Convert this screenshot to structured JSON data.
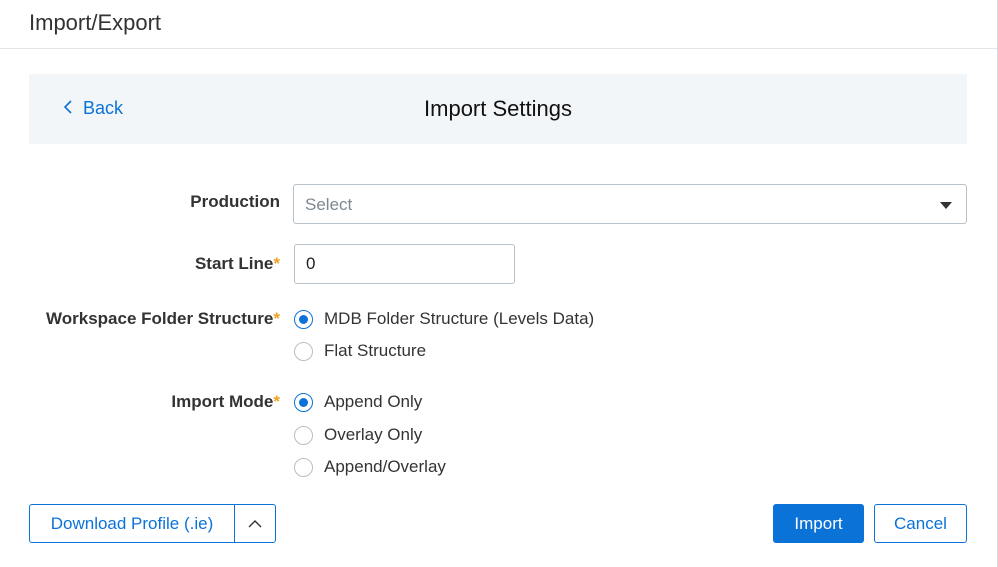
{
  "header": {
    "title": "Import/Export"
  },
  "settings": {
    "back_label": "Back",
    "title": "Import Settings"
  },
  "form": {
    "production": {
      "label": "Production",
      "placeholder": "Select",
      "value": ""
    },
    "start_line": {
      "label": "Start Line",
      "required_mark": "*",
      "value": "0"
    },
    "folder_structure": {
      "label": "Workspace Folder Structure",
      "required_mark": "*",
      "options": [
        {
          "label": "MDB Folder Structure (Levels Data)",
          "selected": true
        },
        {
          "label": "Flat Structure",
          "selected": false
        }
      ]
    },
    "import_mode": {
      "label": "Import Mode",
      "required_mark": "*",
      "options": [
        {
          "label": "Append Only",
          "selected": true
        },
        {
          "label": "Overlay Only",
          "selected": false
        },
        {
          "label": "Append/Overlay",
          "selected": false
        }
      ]
    }
  },
  "footer": {
    "download_label": "Download Profile (.ie)",
    "import_label": "Import",
    "cancel_label": "Cancel"
  },
  "colors": {
    "accent": "#0b72d8",
    "required": "#f0a020",
    "panel_bg": "#f2f6f9"
  },
  "icons": {
    "back": "chevron-left-icon",
    "dropdown": "caret-down-icon",
    "split_toggle": "chevron-up-icon"
  }
}
